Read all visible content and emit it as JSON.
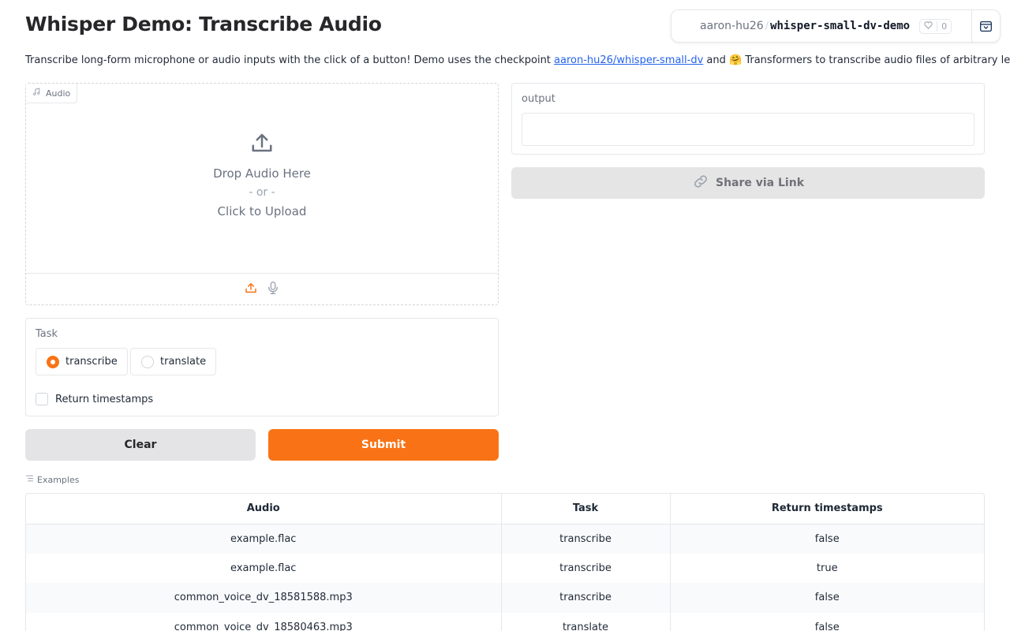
{
  "page": {
    "title": "Whisper Demo: Transcribe Audio",
    "description_pre": "Transcribe long-form microphone or audio inputs with the click of a button! Demo uses the checkpoint ",
    "description_link": "aaron-hu26/whisper-small-dv",
    "description_post": " and 🤗 Transformers to transcribe audio files of arbitrary length."
  },
  "space_badge": {
    "owner": "aaron-hu26",
    "separator": "/",
    "repo": "whisper-small-dv-demo",
    "likes": "0"
  },
  "audio": {
    "label": "Audio",
    "drop_text": "Drop Audio Here",
    "or_text": "- or -",
    "click_text": "Click to Upload"
  },
  "task": {
    "label": "Task",
    "options": [
      "transcribe",
      "translate"
    ],
    "selected": "transcribe",
    "timestamps_label": "Return timestamps",
    "timestamps_checked": false
  },
  "buttons": {
    "clear": "Clear",
    "submit": "Submit",
    "share": "Share via Link"
  },
  "output": {
    "label": "output",
    "value": ""
  },
  "examples": {
    "label": "Examples",
    "headers": [
      "Audio",
      "Task",
      "Return timestamps"
    ],
    "rows": [
      [
        "example.flac",
        "transcribe",
        "false"
      ],
      [
        "example.flac",
        "transcribe",
        "true"
      ],
      [
        "common_voice_dv_18581588.mp3",
        "transcribe",
        "false"
      ],
      [
        "common_voice_dv_18580463.mp3",
        "translate",
        "false"
      ]
    ]
  },
  "colors": {
    "accent": "#f97316",
    "link": "#2563eb",
    "border": "#e5e7eb"
  }
}
